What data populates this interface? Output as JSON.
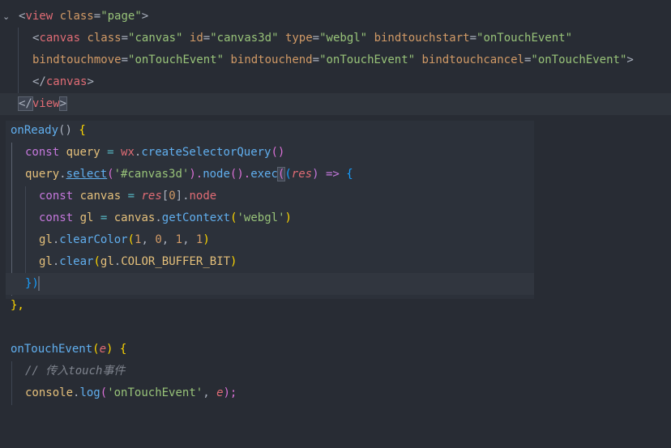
{
  "editor": {
    "lines": [
      [
        "<",
        "view",
        " ",
        "class",
        "=",
        "\"page\"",
        ">"
      ],
      [
        "<",
        "canvas",
        " ",
        "class",
        "=",
        "\"canvas\"",
        " ",
        "id",
        "=",
        "\"canvas3d\"",
        " ",
        "type",
        "=",
        "\"webgl\"",
        " ",
        "bindtouchstart",
        "=",
        "\"onTouchEvent\""
      ],
      [
        "bindtouchmove",
        "=",
        "\"onTouchEvent\"",
        " ",
        "bindtouchend",
        "=",
        "\"onTouchEvent\"",
        " ",
        "bindtouchcancel",
        "=",
        "\"onTouchEvent\"",
        ">"
      ],
      [
        "</",
        "canvas",
        ">"
      ],
      [
        "</",
        "view",
        ">"
      ],
      [
        "onReady",
        "() ",
        "{"
      ],
      [
        "const",
        " ",
        "query",
        " = ",
        "wx",
        ".",
        "createSelectorQuery",
        "()"
      ],
      [
        "query",
        ".",
        "select",
        "(",
        "'#canvas3d'",
        ").",
        "node",
        "().",
        "exec",
        "(",
        "(",
        "res",
        ") => ",
        "{"
      ],
      [
        "const",
        " ",
        "canvas",
        " = ",
        "res",
        "[",
        "0",
        "].",
        "node"
      ],
      [
        "const",
        " ",
        "gl",
        " = ",
        "canvas",
        ".",
        "getContext",
        "(",
        "'webgl'",
        ")"
      ],
      [
        "gl",
        ".",
        "clearColor",
        "(",
        "1",
        ", ",
        "0",
        ", ",
        "1",
        ", ",
        "1",
        ")"
      ],
      [
        "gl",
        ".",
        "clear",
        "(",
        "gl",
        ".",
        "COLOR_BUFFER_BIT",
        ")"
      ],
      [
        "})",
        ""
      ],
      [
        "},",
        ""
      ],
      [
        "",
        ""
      ],
      [
        "onTouchEvent",
        "(",
        "e",
        ") ",
        "{"
      ],
      [
        "// 传入touch事件",
        ""
      ],
      [
        "console",
        ".",
        "log",
        "(",
        "'onTouchEvent'",
        ", ",
        "e",
        ");"
      ]
    ]
  }
}
